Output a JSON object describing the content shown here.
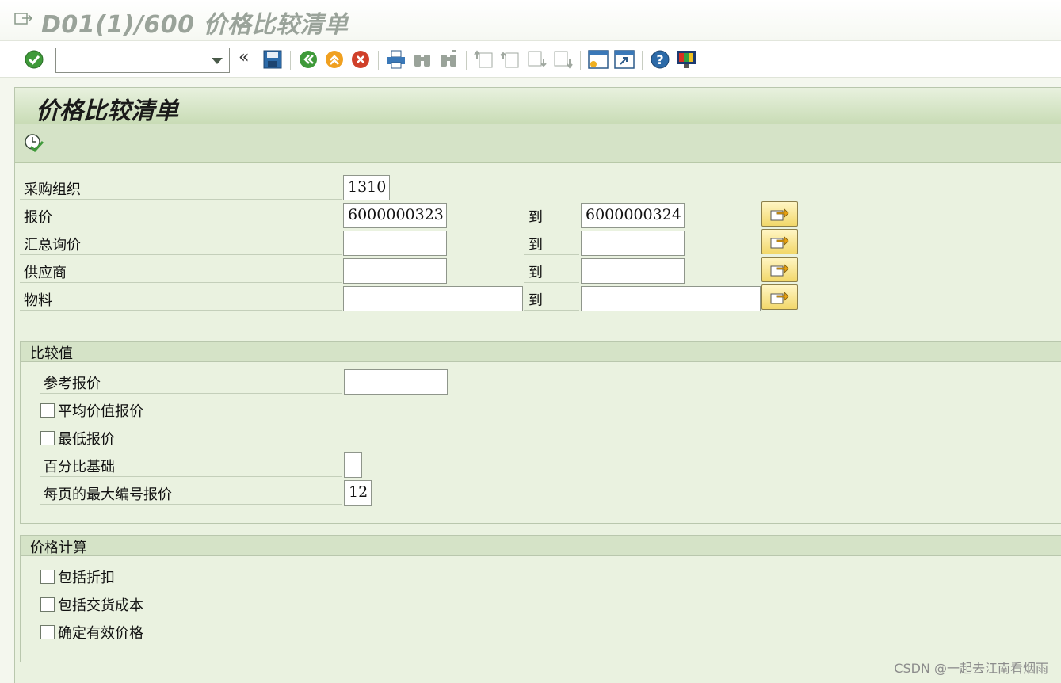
{
  "window": {
    "title": "D01(1)/600 价格比较清单"
  },
  "toolbar": {
    "command_field_value": "",
    "icons": [
      "enter-icon",
      "save-icon",
      "back-icon",
      "exit-icon",
      "cancel-icon",
      "print-icon",
      "find-icon",
      "find-next-icon",
      "first-page-icon",
      "previous-page-icon",
      "next-page-icon",
      "last-page-icon",
      "create-session-icon",
      "shortcut-icon",
      "help-icon",
      "customize-layout-icon"
    ]
  },
  "screen": {
    "heading": "价格比较清单"
  },
  "selection": {
    "purchasing_org": {
      "label": "采购组织",
      "value": "1310"
    },
    "quotation": {
      "label": "报价",
      "from": "6000000323",
      "to_label": "到",
      "to": "6000000324"
    },
    "collective_rfq": {
      "label": "汇总询价",
      "from": "",
      "to_label": "到",
      "to": ""
    },
    "vendor": {
      "label": "供应商",
      "from": "",
      "to_label": "到",
      "to": ""
    },
    "material": {
      "label": "物料",
      "from": "",
      "to_label": "到",
      "to": ""
    }
  },
  "comparison": {
    "title": "比较值",
    "reference_quotation": {
      "label": "参考报价",
      "value": ""
    },
    "mean_value_quotation": {
      "label": "平均价值报价",
      "checked": false
    },
    "minimum_value_quotation": {
      "label": "最低报价",
      "checked": false
    },
    "percentage_basis": {
      "label": "百分比基础",
      "value": ""
    },
    "max_quotations_per_page": {
      "label": "每页的最大编号报价",
      "value": "12"
    }
  },
  "pricing": {
    "title": "价格计算",
    "include_discounts": {
      "label": "包括折扣",
      "checked": false
    },
    "include_delivery_costs": {
      "label": "包括交货成本",
      "checked": false
    },
    "determine_effective_price": {
      "label": "确定有效价格",
      "checked": false
    }
  },
  "watermark": "CSDN @一起去江南看烟雨",
  "colors": {
    "panel_bg": "#eaf2e0",
    "header_green": "#c9dcb6",
    "multiselect_yellow": "#f2d86a"
  }
}
